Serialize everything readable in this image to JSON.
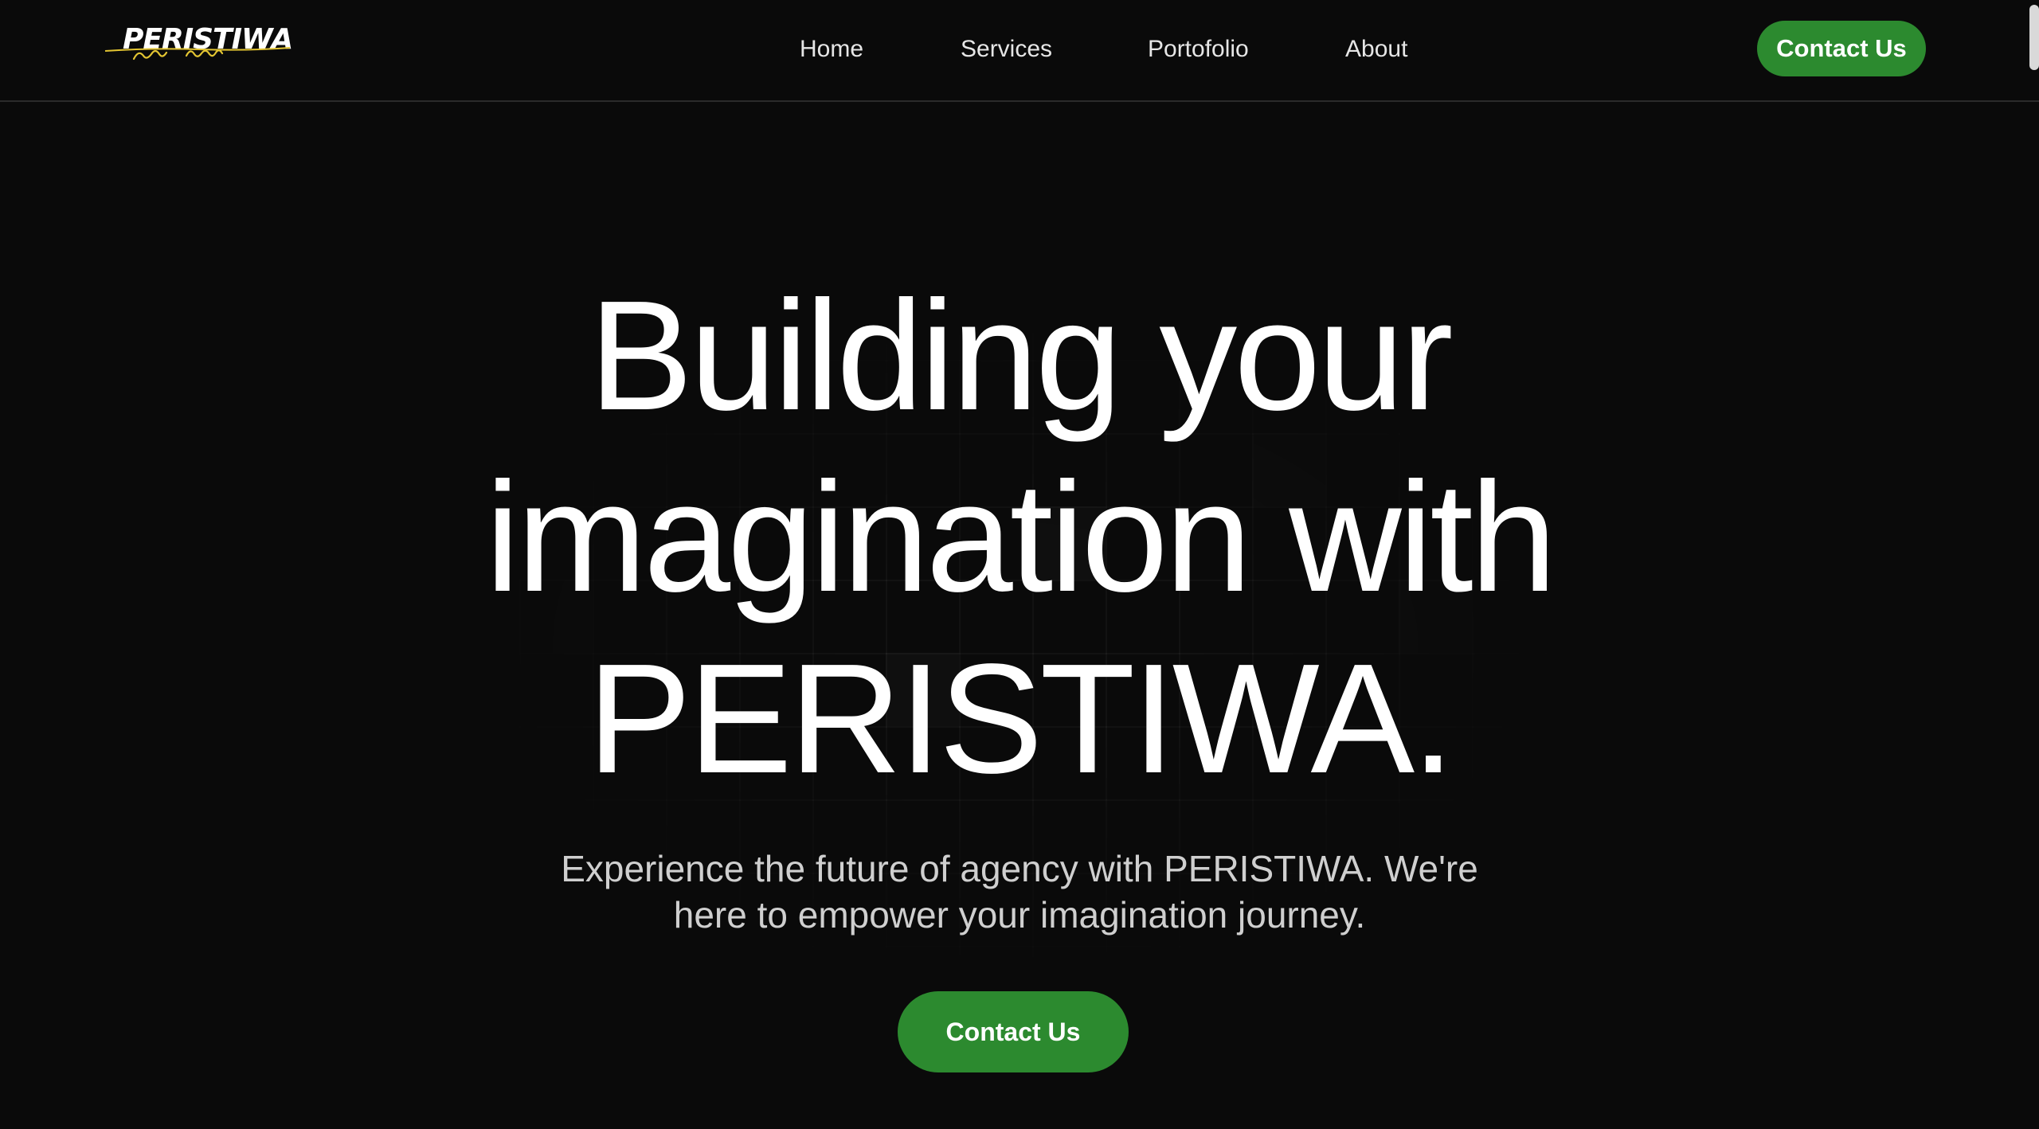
{
  "brand": {
    "logo_text": "PERISTIWA",
    "logo_script_text": "pengalaman istimewa",
    "accent_color": "#e3c532"
  },
  "nav": {
    "items": [
      {
        "label": "Home"
      },
      {
        "label": "Services"
      },
      {
        "label": "Portofolio"
      },
      {
        "label": "About"
      }
    ],
    "cta_label": "Contact Us"
  },
  "hero": {
    "title_lines": [
      "Building your",
      "imagination with",
      "PERISTIWA."
    ],
    "subtitle_lines": [
      "Experience the future of agency with PERISTIWA. We're",
      "here to empower your imagination journey."
    ],
    "cta_label": "Contact Us"
  },
  "colors": {
    "background": "#0a0a0a",
    "button_green": "#2c8a2f",
    "text_primary": "#ffffff",
    "text_secondary": "#cfcfcf"
  }
}
